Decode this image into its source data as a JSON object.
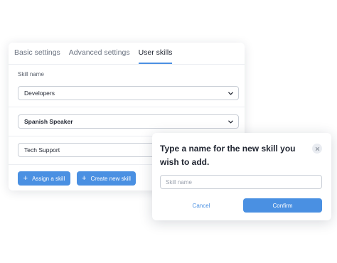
{
  "settings": {
    "tabs": [
      {
        "label": "Basic settings",
        "active": false
      },
      {
        "label": "Advanced settings",
        "active": false
      },
      {
        "label": "User skills",
        "active": true
      }
    ],
    "skill_name_label": "Skill name",
    "skills": [
      {
        "value": "Developers",
        "bold": false
      },
      {
        "value": "Spanish Speaker",
        "bold": true
      },
      {
        "value": "Tech Support",
        "bold": false
      }
    ],
    "assign_button": {
      "icon": "plus-icon",
      "label": "Assign a skill"
    },
    "create_button": {
      "icon": "plus-icon",
      "label": "Create new skill"
    }
  },
  "dialog": {
    "title": "Type a name for the new skill you wish to add.",
    "close_icon": "close-icon",
    "input": {
      "value": "",
      "placeholder": "Skill name"
    },
    "cancel_label": "Cancel",
    "confirm_label": "Confirm"
  },
  "colors": {
    "accent": "#4a90e2",
    "text": "#1f2430",
    "muted": "#6c7482",
    "border": "#c9ced6"
  }
}
